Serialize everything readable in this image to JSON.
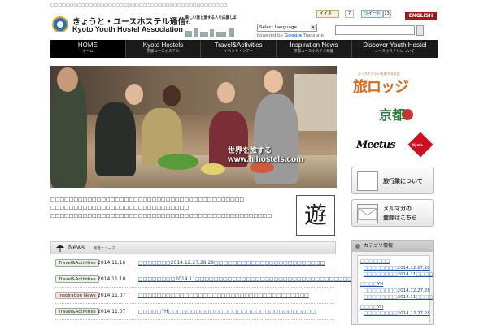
{
  "topline": "□□□□□□□□□□□□□□□□□□□□□□□□□□□□□□□□□□□□□□□□□□□□□□",
  "header": {
    "logo_jp": "きょうと・ユースホステル通信",
    "logo_en": "Kyoto Youth Hostel Association",
    "tagline": "新しい旅と旅する人を応援します。",
    "lang_select": "Select Language",
    "powered_prefix": "Powered by",
    "powered_brand": "Google",
    "powered_suffix": "Translate",
    "like_label": "イイネ！",
    "like_count": "7",
    "tweet_label": "ツイート",
    "tweet_count": "13",
    "english_label": "ENGLISH"
  },
  "nav": [
    {
      "en": "HOME",
      "jp": "ホーム"
    },
    {
      "en": "Kyoto Hostels",
      "jp": "京都ユースホステル"
    },
    {
      "en": "Travel&Activities",
      "jp": "イベント・ツアー"
    },
    {
      "en": "Inspiration News",
      "jp": "京都ユースホステル新聞"
    },
    {
      "en": "Discover Youth Hostel",
      "jp": "ユースホステルについて"
    }
  ],
  "hero": {
    "caption_jp": "世界を旅する",
    "caption_url": "www.hihostels.com"
  },
  "intro": [
    "□□□□□□□□□□□□□□□□□□□□□□□□□□□□□□□□□□□□□□□□□□",
    "□□□□□□□□□□□□□□□□□□□□□□□□□□□□□□",
    "□□□□□□□□□□□□□□□□□□□□□□□□□□□□□□□□□□□□□□□□□□□□□□□□"
  ],
  "stamp_glyph": "遊",
  "news": {
    "title": "News",
    "subtitle": "新着ニュース",
    "items": [
      {
        "cat": "Travel&Activities",
        "date": "2014.11.16",
        "title": "□□□□□□□2014.12.27,28,29□□□□□□□□□□□□□□□□□□□□□□□□",
        "insp": false
      },
      {
        "cat": "Travel&Activities",
        "date": "2014.11.10",
        "title": "□□□□□□□□2014.11□□□□□□□□□□□□□□□□□□□□□□□□□□□□□□□□□□ □ □□□□□",
        "insp": false
      },
      {
        "cat": "Inspiration News",
        "date": "2014.11.07",
        "title": "□□□□□□□□□□□□□□□□□□□□□□□□□□□□□□□□□□□□□",
        "insp": true
      },
      {
        "cat": "Travel&Activities",
        "date": "2014.11.07",
        "title": "□□□□□YH□□□□□□□□□□□□□□□□□□□□□□□□□□□□□□□□",
        "insp": false
      }
    ]
  },
  "sidebar": {
    "tabi_small": "ユースホステルを旅するお店",
    "tabi_text": "旅ロッジ",
    "kyo_text": "京都",
    "meetus_text": "Meetus",
    "meetus_badge": "Kyoto",
    "travel_btn": "旅行業について",
    "mail_btn_line1": "メルマガの",
    "mail_btn_line2": "登録はこちら",
    "category_title": "カテゴリ情報",
    "categories": [
      {
        "group": "□□□□□□□",
        "subs": [
          "□□□□□□□□2014.12.27,28",
          "□□□□□□□□2014.11□□□□"
        ]
      },
      {
        "group": "□□□□YH",
        "subs": [
          "□□□□□□□□2014.12.27,28",
          "□□□□□□□□2014.11□□□□"
        ]
      },
      {
        "group": "□□□□YH",
        "subs": [
          "□□□□□□□□2014.12.27,28"
        ]
      }
    ]
  },
  "colors": {
    "nav_bg": "#1a1a1a",
    "english_btn": "#9e1b1b",
    "link": "#1d4e9b"
  }
}
